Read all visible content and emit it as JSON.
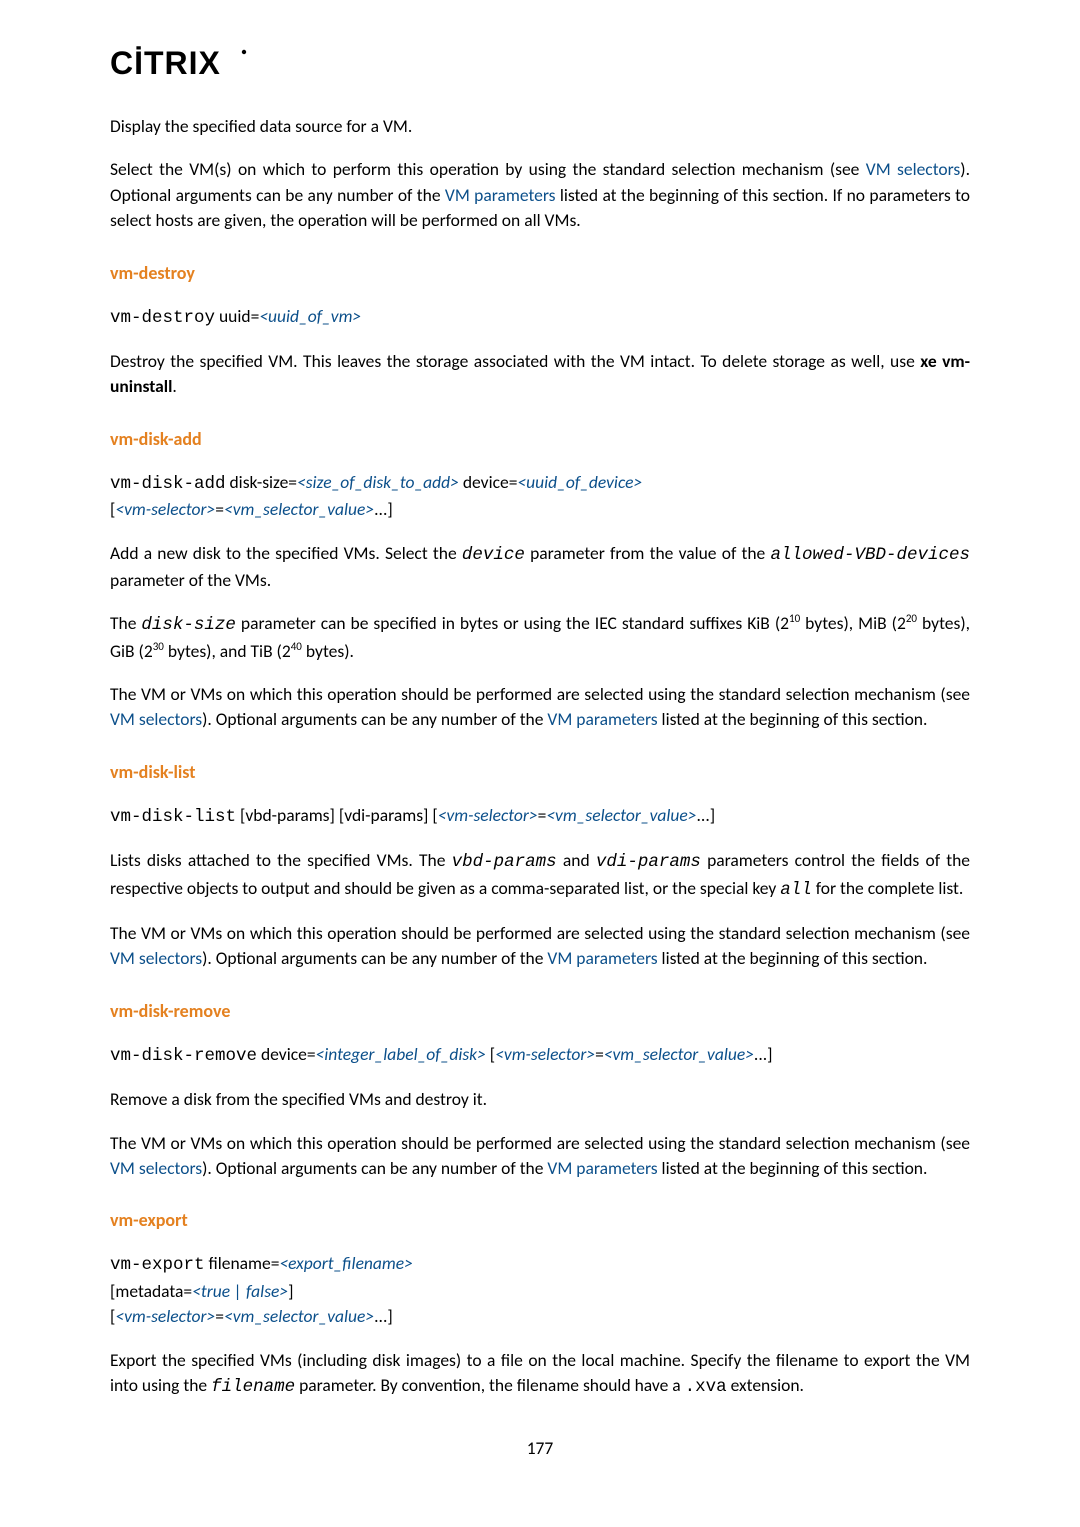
{
  "logo": {
    "text": "CİTRIX",
    "mark": "˙"
  },
  "p_intro_1": "Display the specified data source for a VM.",
  "p_intro_2a": "Select the VM(s) on which to perform this operation by using the standard selection mechanism (see ",
  "p_intro_2_link1": "VM selectors",
  "p_intro_2b": "). Optional arguments can be any number of the ",
  "p_intro_2_link2": "VM parameters",
  "p_intro_2c": " listed at the beginning of this section. If no parameters to select hosts are given, the operation will be performed on all VMs.",
  "h_vm_destroy": "vm-destroy",
  "vm_destroy_cmd": "vm-destroy",
  "vm_destroy_uuid_label": " uuid=",
  "vm_destroy_uuid_kw": "<uuid_of_vm>",
  "vm_destroy_body_a": "Destroy the specified VM. This leaves the storage associated with the VM intact. To delete storage as well, use ",
  "vm_destroy_body_b": "xe vm-uninstall",
  "vm_destroy_body_c": ".",
  "h_vm_disk_add": "vm-disk-add",
  "vda_cmd": "vm-disk-add",
  "vda_disk_size_label": " disk-size=",
  "vda_disk_size_kw": "<size_of_disk_to_add>",
  "vda_device_label": " device=",
  "vda_device_kw": "<uuid_of_device>",
  "vda_sel_open": "[",
  "vda_sel_l": "<vm-selector>",
  "vda_sel_eq": "=",
  "vda_sel_r": "<vm_selector_value>",
  "vda_sel_close": "...]",
  "vda_p1a": "Add a new disk to the specified VMs. Select the ",
  "vda_p1_code1": "device",
  "vda_p1b": " parameter from the value of the ",
  "vda_p1_code2": "allowed-VBD-devices",
  "vda_p1c": " parameter of the VMs.",
  "vda_p2a": "The ",
  "vda_p2_code1": "disk-size",
  "vda_p2b": " parameter can be specified in bytes or using the IEC standard suffixes KiB (2",
  "vda_p2_sup1": "10",
  "vda_p2c": " bytes), MiB (2",
  "vda_p2_sup2": "20",
  "vda_p2d": " bytes), GiB (2",
  "vda_p2_sup3": "30",
  "vda_p2e": " bytes), and TiB (2",
  "vda_p2_sup4": "40",
  "vda_p2f": " bytes).",
  "p_std_a": "The VM or VMs on which this operation should be performed are selected using the standard selection mechanism (see ",
  "p_std_link1": "VM selectors",
  "p_std_b": "). Optional arguments can be any number of the ",
  "p_std_link2": "VM parameters",
  "p_std_c": " listed at the beginning of this section.",
  "h_vm_disk_list": "vm-disk-list",
  "vdl_cmd": "vm-disk-list",
  "vdl_args": " [vbd-params] [vdi-params] [",
  "vdl_sel_l": "<vm-selector>",
  "vdl_sel_eq": "=",
  "vdl_sel_r": "<vm_selector_value>",
  "vdl_sel_close": "...]",
  "vdl_p1a": "Lists disks attached to the specified VMs. The ",
  "vdl_p1_code1": "vbd-params",
  "vdl_p1b": " and ",
  "vdl_p1_code2": "vdi-params",
  "vdl_p1c": " parameters control the fields of the respective objects to output and should be given as a comma-separated list, or the special key ",
  "vdl_p1_code3": "all",
  "vdl_p1d": " for the complete list.",
  "h_vm_disk_remove": "vm-disk-remove",
  "vdr_cmd": "vm-disk-remove",
  "vdr_device_label": " device=",
  "vdr_device_kw": "<integer_label_of_disk>",
  "vdr_sel_open": " [",
  "vdr_sel_l": "<vm-selector>",
  "vdr_sel_eq": "=",
  "vdr_sel_r": "<vm_selector_value>",
  "vdr_sel_close": "...]",
  "vdr_p1": "Remove a disk from the specified VMs and destroy it.",
  "h_vm_export": "vm-export",
  "vex_cmd": "vm-export",
  "vex_fn_label": " filename=",
  "vex_fn_kw": "<export_filename>",
  "vex_meta_open": "[metadata=",
  "vex_meta_kw": "<true | false>",
  "vex_meta_close": "]",
  "vex_sel_open": "[",
  "vex_sel_l": "<vm-selector>",
  "vex_sel_eq": "=",
  "vex_sel_r": "<vm_selector_value>",
  "vex_sel_close": "...]",
  "vex_p1a": "Export the specified VMs (including disk images) to a file on the local machine. Specify the filename to export the VM into using the ",
  "vex_p1_code1": "filename",
  "vex_p1b": " parameter. By convention, the filename should have a ",
  "vex_p1_code2": ".xva",
  "vex_p1c": " extension.",
  "page_number": "177"
}
